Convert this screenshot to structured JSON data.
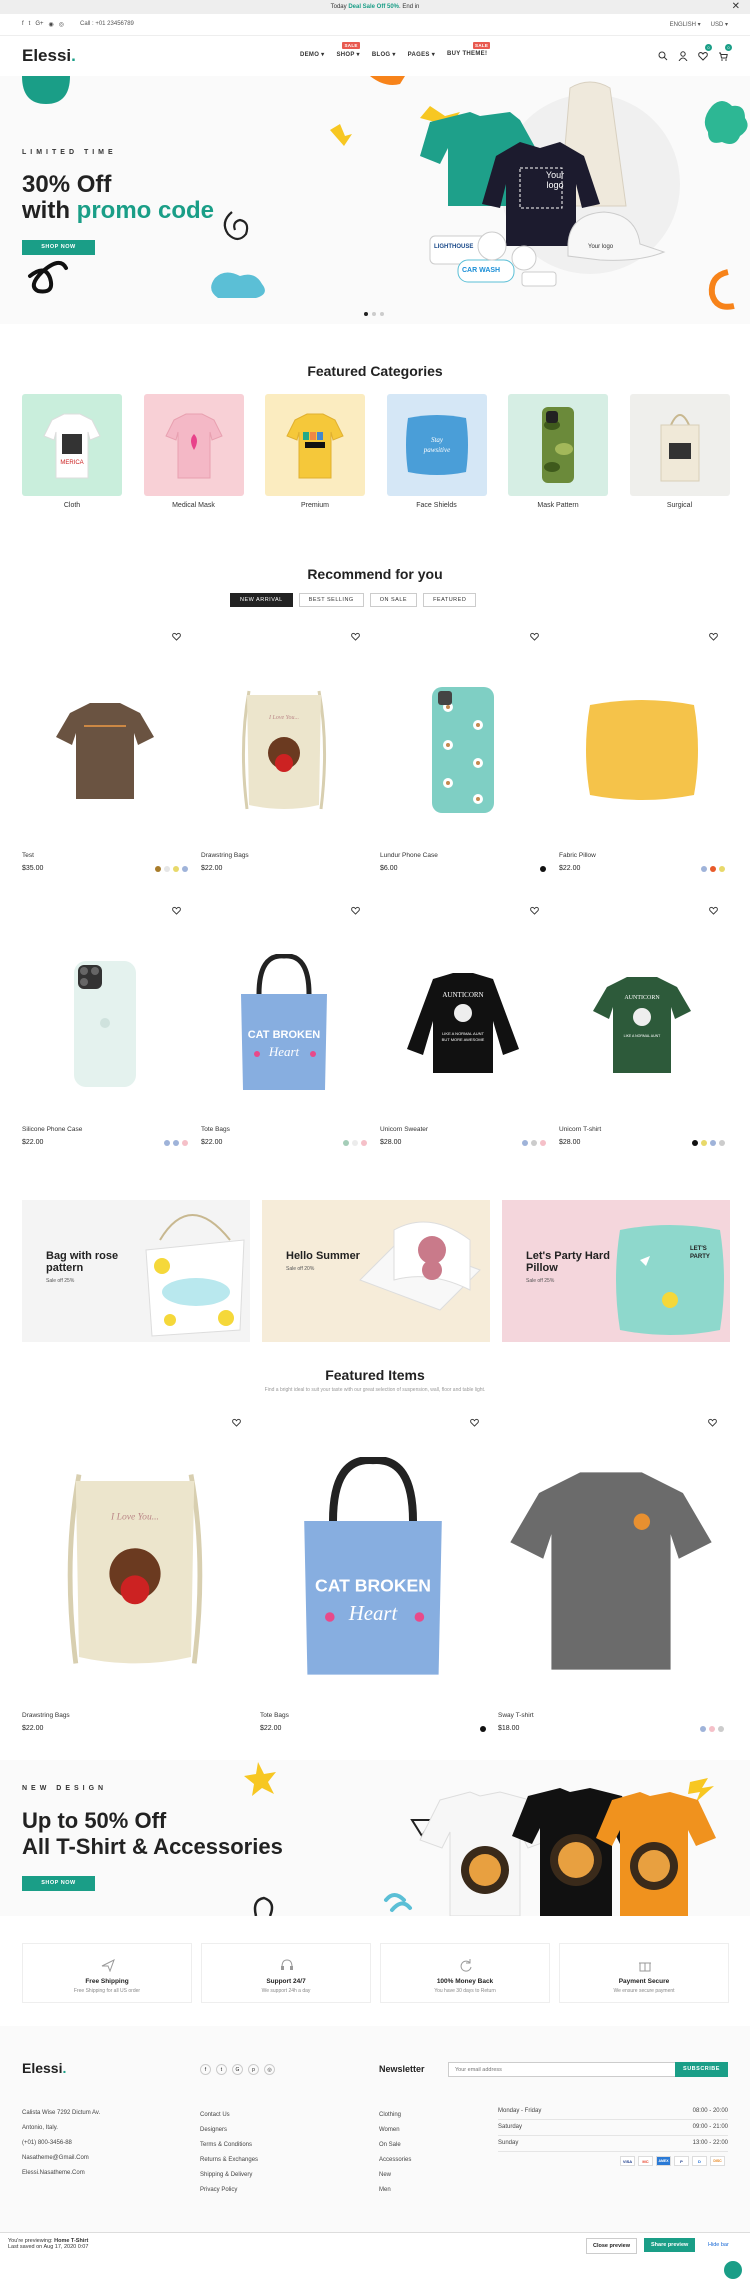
{
  "topbar": {
    "prefix": "Today ",
    "highlight": "Deal Sale Off 50%",
    "suffix": ". End in",
    "close": "✕"
  },
  "subbar": {
    "call": "Call : +01 23456789",
    "lang": "ENGLISH ▾",
    "currency": "USD ▾",
    "social": [
      "f",
      "t",
      "G+",
      "◉",
      "◎"
    ]
  },
  "header": {
    "logo": "Elessi",
    "logo_dot": ".",
    "nav": [
      {
        "label": "DEMO ▾",
        "badge": ""
      },
      {
        "label": "SHOP ▾",
        "badge": "SALE"
      },
      {
        "label": "BLOG ▾",
        "badge": ""
      },
      {
        "label": "PAGES ▾",
        "badge": ""
      },
      {
        "label": "BUY THEME!",
        "badge": "SALE"
      }
    ],
    "wishlist_count": "0",
    "cart_count": "0"
  },
  "hero": {
    "kicker": "LIMITED TIME",
    "line1": "30% Off",
    "line2a": "with ",
    "line2b": "promo code",
    "button": "SHOP NOW",
    "logo_text_1": "Your",
    "logo_text_2": "logo",
    "cap_text": "Your logo",
    "sticker_1": "LIGHTHOUSE",
    "sticker_2": "CAR WASH"
  },
  "categories": {
    "title": "Featured Categories",
    "items": [
      {
        "label": "Cloth",
        "bg": "#c9eedc",
        "tshirt": "MERICA"
      },
      {
        "label": "Medical Mask",
        "bg": "#f8d0d6"
      },
      {
        "label": "Premium",
        "bg": "#fbecc0"
      },
      {
        "label": "Face Shields",
        "bg": "#d5e7f6",
        "pillow": "Stay pawsitive"
      },
      {
        "label": "Mask Pattern",
        "bg": "#d6eee4"
      },
      {
        "label": "Surgical",
        "bg": "#efefec"
      }
    ]
  },
  "recommend": {
    "title": "Recommend for you",
    "tabs": [
      "NEW ARRIVAL",
      "BEST SELLING",
      "ON SALE",
      "FEATURED"
    ],
    "products": [
      {
        "name": "Test",
        "price": "$35.00",
        "swatches": [
          "#a87c2a",
          "#e6e6e6",
          "#e8d96a",
          "#9fb3d9"
        ]
      },
      {
        "name": "Drawstring Bags",
        "price": "$22.00",
        "swatches": []
      },
      {
        "name": "Lundur Phone Case",
        "price": "$6.00",
        "swatches": [
          "#111111"
        ]
      },
      {
        "name": "Fabric Pillow",
        "price": "$22.00",
        "swatches": [
          "#9fb3d9",
          "#e85a2a",
          "#e8d96a"
        ]
      },
      {
        "name": "Silicone Phone Case",
        "price": "$22.00",
        "swatches": [
          "#9fb3d9",
          "#9fb3d9",
          "#f5c0c8"
        ]
      },
      {
        "name": "Tote Bags",
        "price": "$22.00",
        "swatches": [
          "#a5cdb8",
          "#ececec",
          "#f5c0c8"
        ]
      },
      {
        "name": "Unicorn Sweater",
        "price": "$28.00",
        "swatches": [
          "#9fb3d9",
          "#ccc",
          "#f5c0c8"
        ]
      },
      {
        "name": "Unicorn T-shirt",
        "price": "$28.00",
        "swatches": [
          "#111111",
          "#e8d96a",
          "#9fb3d9",
          "#ccc"
        ]
      }
    ],
    "tote_text_1": "CAT BROKEN",
    "tote_text_2": "Heart",
    "sweater_text": "AUNTICORN",
    "sweater_sub": "LIKE A NORMAL AUNT BUT MORE AWESOME",
    "bag_text": "I Love You..."
  },
  "promos": [
    {
      "title": "Bag with rose pattern",
      "sub": "Sale off 25%",
      "bg": "#f4f4f4"
    },
    {
      "title": "Hello Summer",
      "sub": "Sale off 20%",
      "bg": "#f6ecd9"
    },
    {
      "title": "Let's Party Hard Pillow",
      "sub": "Sale off 25%",
      "bg": "#f4d6dc"
    }
  ],
  "featured": {
    "title": "Featured Items",
    "sub": "Find a bright ideal to suit your taste with our great selection of suspension, wall, floor and table light.",
    "products": [
      {
        "name": "Drawstring Bags",
        "price": "$22.00",
        "swatches": []
      },
      {
        "name": "Tote Bags",
        "price": "$22.00",
        "swatches": [
          "#111111"
        ]
      },
      {
        "name": "Sway T-shirt",
        "price": "$18.00",
        "swatches": [
          "#9fb3d9",
          "#f5c0c8",
          "#ccc"
        ]
      }
    ]
  },
  "banner2": {
    "kicker": "NEW DESIGN",
    "line1": "Up to 50% Off",
    "line2": "All T-Shirt & Accessories",
    "button": "SHOP NOW"
  },
  "features": [
    {
      "title": "Free Shipping",
      "desc": "Free Shipping for all US order",
      "icon": "plane-icon"
    },
    {
      "title": "Support 24/7",
      "desc": "We support 24h a day",
      "icon": "headset-icon"
    },
    {
      "title": "100% Money Back",
      "desc": "You have 30 days to Return",
      "icon": "refresh-icon"
    },
    {
      "title": "Payment Secure",
      "desc": "We ensure secure payment",
      "icon": "gift-icon"
    }
  ],
  "footer": {
    "logo": "Elessi",
    "newsletter": "Newsletter",
    "email_placeholder": "Your email address",
    "subscribe": "SUBSCRIBE",
    "contact": [
      "Calista Wise 7292 Dictum Av.",
      "Antonio, Italy.",
      "(+01) 800-3456-88",
      "Nasatheme@Gmail.Com",
      "Elessi.Nasatheme.Com"
    ],
    "links1": [
      "Contact Us",
      "Designers",
      "Terms & Conditions",
      "Returns & Exchanges",
      "Shipping & Delivery",
      "Privacy Policy"
    ],
    "links2": [
      "Clothing",
      "Women",
      "On Sale",
      "Accessories",
      "New",
      "Men"
    ],
    "hours": [
      [
        "Monday - Friday",
        "08:00 - 20:00"
      ],
      [
        "Saturday",
        "09:00 - 21:00"
      ],
      [
        "Sunday",
        "13:00 - 22:00"
      ]
    ],
    "payments": [
      "VISA",
      "MC",
      "AMEX",
      "P",
      "D",
      "DISC"
    ]
  },
  "bottombar": {
    "previewing_prefix": "You're previewing: ",
    "previewing_name": "Home T-Shirt",
    "saved": "Last saved on Aug 17, 2020 0:07",
    "close": "Close preview",
    "share": "Share preview",
    "hide": "Hide bar"
  }
}
